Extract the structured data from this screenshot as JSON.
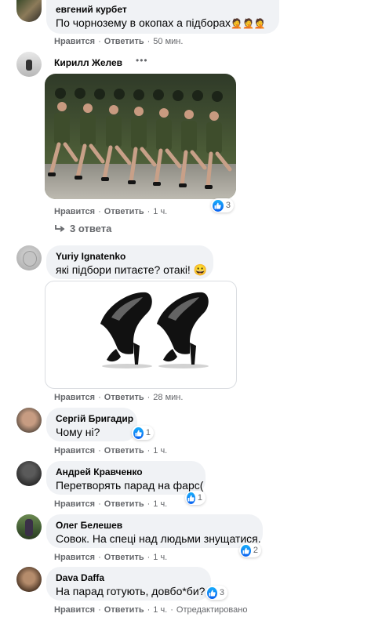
{
  "action_labels": {
    "like": "Нравится",
    "reply": "Ответить"
  },
  "comments": [
    {
      "name": "евгений курбет",
      "text": "По чорнозему в окопах а підборах",
      "emoji": "🤦🤦🤦",
      "time": "50 мин."
    },
    {
      "name": "Кирилл Желев",
      "more": "•••",
      "time": "1 ч.",
      "reactions": "3",
      "replies_label": "3 ответа"
    },
    {
      "name": "Yuriy Ignatenko",
      "text": "які підбори питаєте? отакі!",
      "emoji": "😀",
      "time": "28 мин."
    },
    {
      "name": "Сергій Бригадир",
      "text": "Чому ні?",
      "time": "1 ч.",
      "reactions": "1"
    },
    {
      "name": "Андрей Кравченко",
      "text": "Перетворять парад на фарс(",
      "time": "1 ч.",
      "reactions": "1"
    },
    {
      "name": "Олег Белешев",
      "text": "Совок. На спеці над людьми знущатися.",
      "time": "1 ч.",
      "reactions": "2"
    },
    {
      "name": "Dava Daffa",
      "text": "На парад готують, довбо*би?",
      "time": "1 ч.",
      "reactions": "3",
      "edited": "Отредактировано"
    }
  ],
  "colors": {
    "bubble": "#f0f2f5",
    "meta": "#65676b",
    "like_blue": "#1877f2"
  },
  "icons": [
    "reply-arrow-icon",
    "like-icon",
    "more-options-icon"
  ]
}
